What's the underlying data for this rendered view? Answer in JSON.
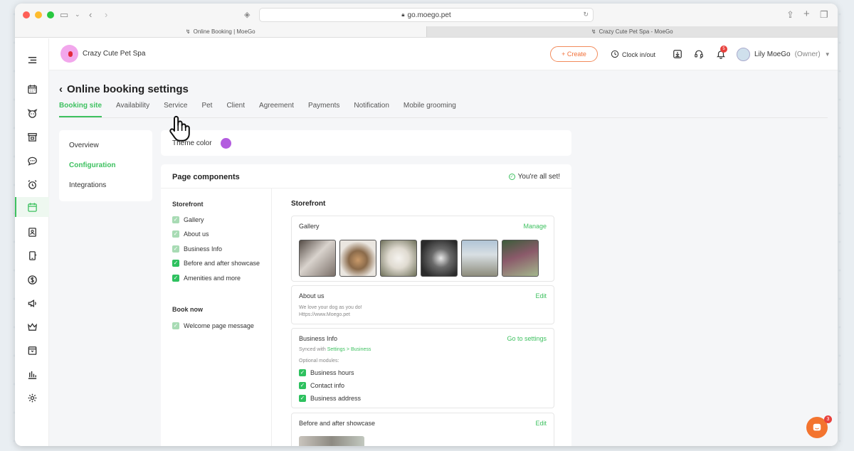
{
  "browser": {
    "url": "go.moego.pet",
    "tabs": [
      {
        "label": "Online Booking | MoeGo"
      },
      {
        "label": "Crazy Cute Pet Spa - MoeGo"
      }
    ]
  },
  "topbar": {
    "business_name": "Crazy Cute Pet Spa",
    "create_label": "+ Create",
    "clock_label": "Clock in/out",
    "notification_count": "5",
    "user_name": "Lily MoeGo",
    "user_role": "(Owner)"
  },
  "page": {
    "title": "Online booking settings",
    "tabs": [
      {
        "label": "Booking site"
      },
      {
        "label": "Availability"
      },
      {
        "label": "Service"
      },
      {
        "label": "Pet"
      },
      {
        "label": "Client"
      },
      {
        "label": "Agreement"
      },
      {
        "label": "Payments"
      },
      {
        "label": "Notification"
      },
      {
        "label": "Mobile grooming"
      }
    ]
  },
  "subnav": {
    "items": [
      {
        "label": "Overview"
      },
      {
        "label": "Configuration"
      },
      {
        "label": "Integrations"
      }
    ]
  },
  "theme": {
    "label": "Theme color",
    "color": "#b35cdf"
  },
  "components": {
    "title": "Page components",
    "status": "You're all set!",
    "storefront_heading": "Storefront",
    "storefront_items": [
      {
        "label": "Gallery"
      },
      {
        "label": "About us"
      },
      {
        "label": "Business Info"
      },
      {
        "label": "Before and after showcase"
      },
      {
        "label": "Amenities and more"
      }
    ],
    "booknow_heading": "Book now",
    "booknow_items": [
      {
        "label": "Welcome page message"
      }
    ],
    "preview_heading": "Storefront",
    "gallery": {
      "title": "Gallery",
      "action": "Manage"
    },
    "about": {
      "title": "About us",
      "action": "Edit",
      "line1": "We love your dog as you do!",
      "line2": "Https://www.Moego.pet"
    },
    "business": {
      "title": "Business Info",
      "action": "Go to settings",
      "synced_prefix": "Synced with ",
      "synced_link": "Settings > Business",
      "optional_label": "Optional modules:",
      "modules": [
        {
          "label": "Business hours"
        },
        {
          "label": "Contact info"
        },
        {
          "label": "Business address"
        }
      ]
    },
    "showcase": {
      "title": "Before and after showcase",
      "action": "Edit"
    }
  },
  "chat": {
    "badge": "3"
  },
  "colors": {
    "accent": "#3ec160",
    "create": "#f2713a"
  }
}
